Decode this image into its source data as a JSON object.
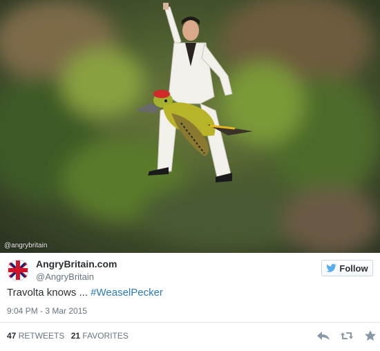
{
  "media": {
    "watermark": "@angrybritain"
  },
  "user": {
    "display_name": "AngryBritain.com",
    "screen_name": "@AngryBritain",
    "avatar_icon": "union-jack-avatar-icon"
  },
  "follow": {
    "label": "Follow",
    "icon": "twitter-bird-icon"
  },
  "tweet": {
    "text": "Travolta knows ... ",
    "hashtag": "#WeaselPecker",
    "timestamp": "9:04 PM - 3 Mar 2015"
  },
  "stats": {
    "retweets_count": "47",
    "retweets_label": "RETWEETS",
    "favorites_count": "21",
    "favorites_label": "FAVORITES"
  },
  "actions": {
    "reply_icon": "reply-icon",
    "retweet_icon": "retweet-icon",
    "favorite_icon": "star-icon"
  },
  "colors": {
    "link": "#2b7bb9",
    "text": "#292f33",
    "muted": "#66757f",
    "border": "#e1e8ed"
  }
}
